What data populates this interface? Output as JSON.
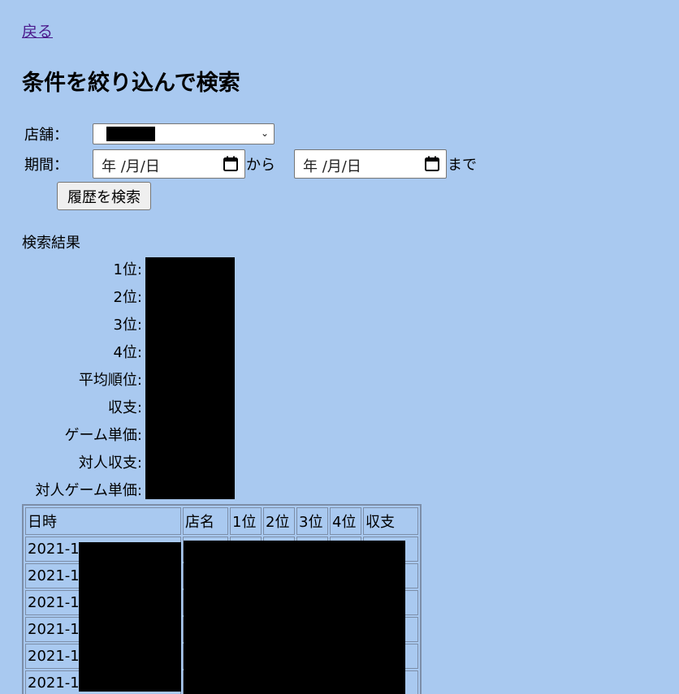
{
  "nav": {
    "back_label": "戻る"
  },
  "page_title": "条件を絞り込んで検索",
  "form": {
    "store_label": "店舗：",
    "period_label": "期間：",
    "date_from_placeholder": "年 /月/日",
    "date_to_placeholder": "年 /月/日",
    "from_text": "から",
    "to_text": "まで",
    "search_button_label": "履歴を検索"
  },
  "results": {
    "title": "検索結果",
    "stats": [
      "1位:",
      "2位:",
      "3位:",
      "4位:",
      "平均順位:",
      "収支:",
      "ゲーム単価:",
      "対人収支:",
      "対人ゲーム単価:"
    ]
  },
  "history_table": {
    "headers": [
      "日時",
      "店名",
      "1位",
      "2位",
      "3位",
      "4位",
      "収支"
    ],
    "rows": [
      "2021-1",
      "2021-1",
      "2021-1",
      "2021-1",
      "2021-1",
      "2021-1"
    ]
  },
  "icons": {
    "store_select": "chevron-down-icon",
    "date_inputs": "calendar-icon"
  }
}
